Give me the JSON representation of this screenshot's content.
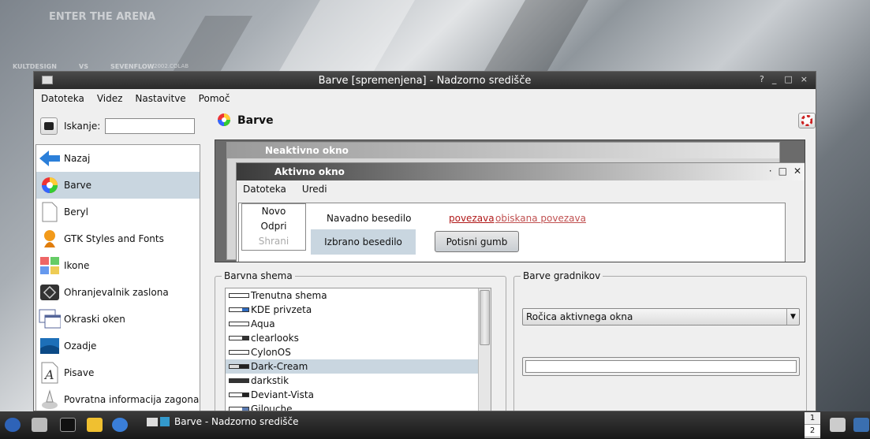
{
  "window": {
    "title": "Barve [spremenjena] - Nadzorno središče",
    "controls": [
      "?",
      "_",
      "□",
      "×"
    ]
  },
  "menu": [
    {
      "label": "Datoteka",
      "accel": "D"
    },
    {
      "label": "Videz",
      "accel": "V"
    },
    {
      "label": "Nastavitve",
      "accel": "N"
    },
    {
      "label": "Pomoč",
      "accel": "P"
    }
  ],
  "search": {
    "label": "Iskanje:",
    "value": ""
  },
  "sidebar": {
    "items": [
      {
        "label": "Nazaj",
        "icon": "back-arrow-icon"
      },
      {
        "label": "Barve",
        "icon": "color-wheel-icon",
        "selected": true
      },
      {
        "label": "Beryl",
        "icon": "document-icon"
      },
      {
        "label": "GTK Styles and Fonts",
        "icon": "gtk-icon"
      },
      {
        "label": "Ikone",
        "icon": "icons-icon"
      },
      {
        "label": "Ohranjevalnik zaslona",
        "icon": "screensaver-icon"
      },
      {
        "label": "Okraski oken",
        "icon": "window-decorations-icon"
      },
      {
        "label": "Ozadje",
        "icon": "wallpaper-icon"
      },
      {
        "label": "Pisave",
        "icon": "font-icon"
      },
      {
        "label": "Povratna informacija zagona",
        "icon": "launch-feedback-icon"
      }
    ]
  },
  "module": {
    "title": "Barve"
  },
  "preview": {
    "inactive_title": "Neaktivno okno",
    "active_title": "Aktivno okno",
    "menu": [
      "Datoteka",
      "Uredi"
    ],
    "popup": [
      "Novo",
      "Odpri",
      "Shrani"
    ],
    "normal_text": "Navadno besedilo",
    "link": "povezava",
    "visited_link": "obiskana povezava",
    "selected_text": "Izbrano besedilo",
    "button": "Potisni gumb"
  },
  "schemes": {
    "title": "Barvna shema",
    "items": [
      {
        "label": "Trenutna shema"
      },
      {
        "label": "KDE privzeta"
      },
      {
        "label": "Aqua"
      },
      {
        "label": "clearlooks"
      },
      {
        "label": "CylonOS"
      },
      {
        "label": "Dark-Cream",
        "selected": true
      },
      {
        "label": "darkstik"
      },
      {
        "label": "Deviant-Vista"
      },
      {
        "label": "Gilouche"
      }
    ]
  },
  "widgets": {
    "title": "Barve gradnikov",
    "accel": "B",
    "selected": "Ročica aktivnega okna"
  },
  "taskbar": {
    "task_label": "Barve - Nadzorno središče",
    "pager": [
      "1",
      "2"
    ]
  },
  "wallpaper": {
    "texts": [
      "ENTER THE ARENA",
      "KULTDESIGN",
      "VS",
      "SEVENFLOW",
      "2002.COLAB"
    ]
  }
}
